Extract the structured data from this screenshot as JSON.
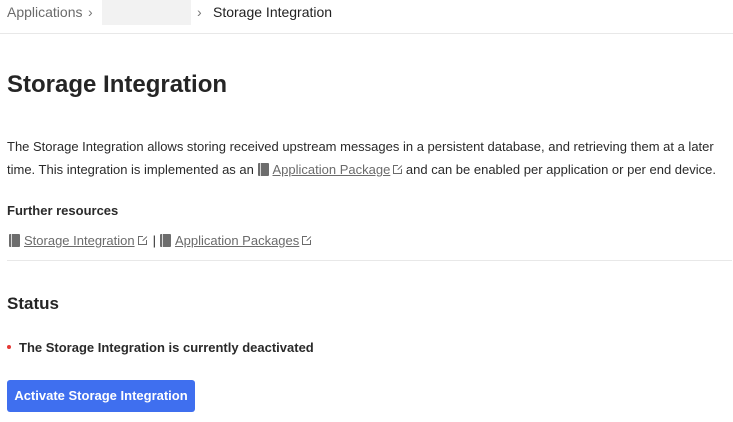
{
  "breadcrumb": {
    "items": [
      "Applications",
      "",
      "Storage Integration"
    ],
    "separator": "›"
  },
  "page": {
    "title": "Storage Integration"
  },
  "description": {
    "part1": "The Storage Integration allows storing received upstream messages in a persistent database, and retrieving them at a later time. This integration is implemented as an ",
    "link_label": "Application Package",
    "part2": " and can be enabled per application or per end device."
  },
  "further_resources": {
    "heading": "Further resources",
    "links": [
      "Storage Integration",
      "Application Packages"
    ],
    "separator": "|"
  },
  "status": {
    "heading": "Status",
    "message": "The Storage Integration is currently deactivated",
    "indicator_color": "#e53935"
  },
  "actions": {
    "activate_label": "Activate Storage Integration",
    "button_color": "#3f6fef"
  },
  "icons": {
    "doc": "book-icon",
    "external": "external-link-icon",
    "chevron": "chevron-right-icon"
  }
}
